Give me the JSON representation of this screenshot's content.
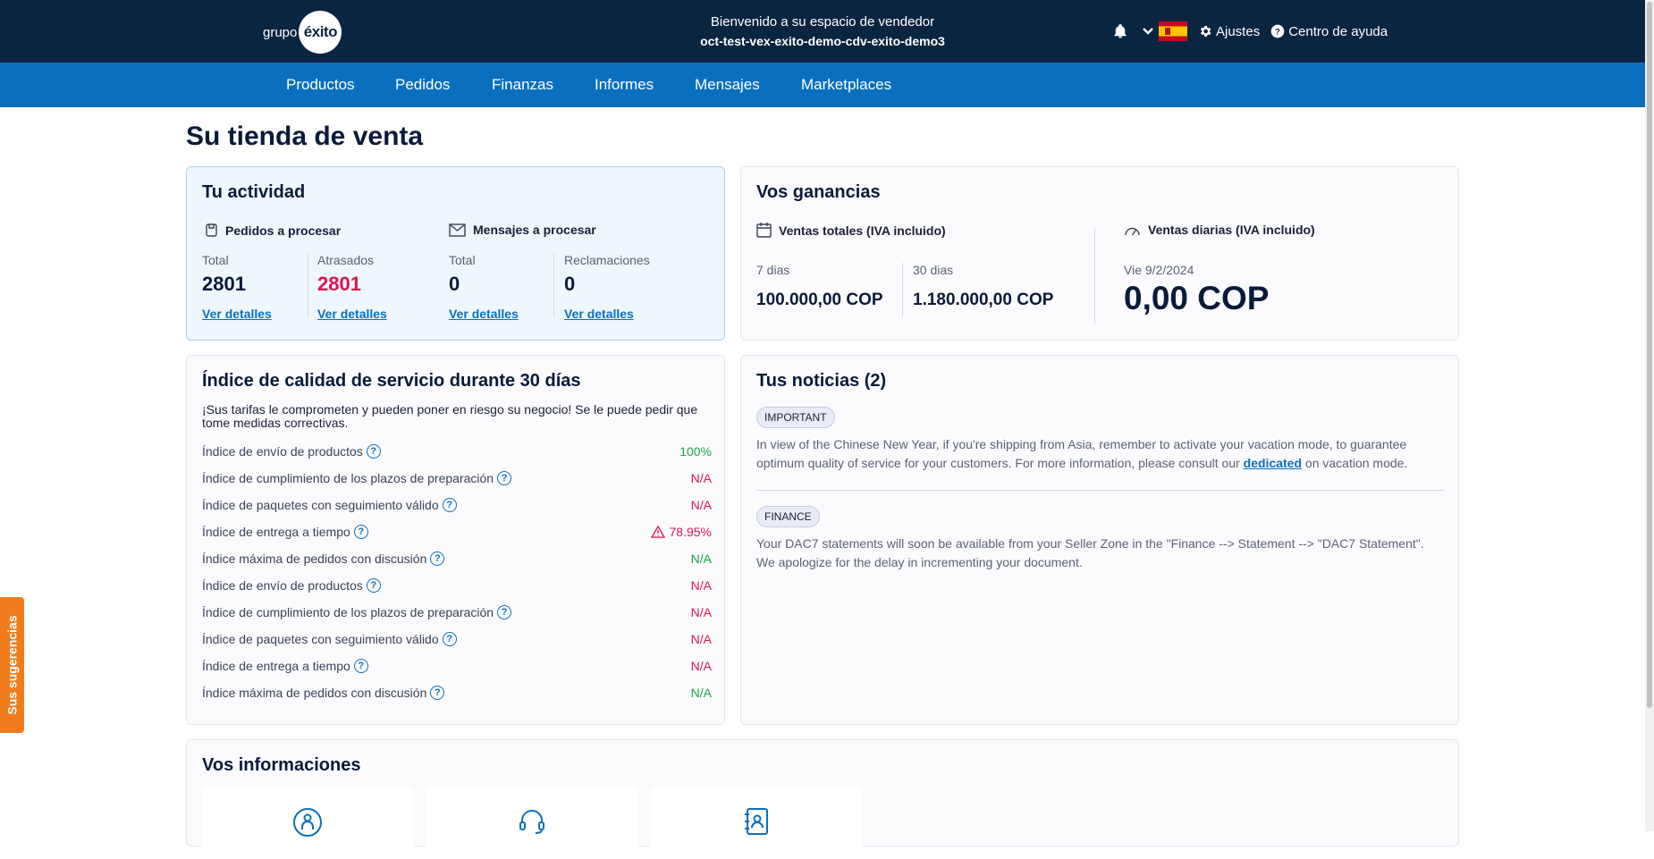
{
  "header": {
    "logo_prefix": "grupo",
    "logo_brand": "éxito",
    "welcome": "Bienvenido a su espacio de vendedor",
    "account": "oct-test-vex-exito-demo-cdv-exito-demo3",
    "settings_label": "Ajustes",
    "help_label": "Centro de ayuda"
  },
  "nav": [
    "Productos",
    "Pedidos",
    "Finanzas",
    "Informes",
    "Mensajes",
    "Marketplaces"
  ],
  "page_title": "Su tienda de venta",
  "activity": {
    "title": "Tu actividad",
    "orders_heading": "Pedidos a procesar",
    "messages_heading": "Mensajes a procesar",
    "stats": [
      {
        "label": "Total",
        "value": "2801",
        "link": "Ver detalles"
      },
      {
        "label": "Atrasados",
        "value": "2801",
        "link": "Ver detalles"
      },
      {
        "label": "Total",
        "value": "0",
        "link": "Ver detalles"
      },
      {
        "label": "Reclamaciones",
        "value": "0",
        "link": "Ver detalles"
      }
    ]
  },
  "earnings": {
    "title": "Vos ganancias",
    "total_heading": "Ventas totales (IVA incluido)",
    "daily_heading": "Ventas diarias (IVA incluido)",
    "period_7_label": "7 dias",
    "period_7_value": "100.000,00 COP",
    "period_30_label": "30 dias",
    "period_30_value": "1.180.000,00 COP",
    "daily_date": "Vie 9/2/2024",
    "daily_value": "0,00 COP"
  },
  "quality": {
    "title": "Índice de calidad de servicio durante 30 días",
    "warning": "¡Sus tarifas le comprometen y pueden poner en riesgo su negocio! Se le puede pedir que tome medidas correctivas.",
    "rows": [
      {
        "label": "Índice de envío de productos",
        "value": "100%",
        "status": "green",
        "warn": false
      },
      {
        "label": "Índice de cumplimiento de los plazos de preparación",
        "value": "N/A",
        "status": "red",
        "warn": false
      },
      {
        "label": "Índice de paquetes con seguimiento válido",
        "value": "N/A",
        "status": "red",
        "warn": false
      },
      {
        "label": "Índice de entrega a tiempo",
        "value": "78.95%",
        "status": "red",
        "warn": true
      },
      {
        "label": "Índice máxima de pedidos con discusión",
        "value": "N/A",
        "status": "green",
        "warn": false
      },
      {
        "label": "Índice de envío de productos",
        "value": "N/A",
        "status": "red",
        "warn": false
      },
      {
        "label": "Índice de cumplimiento de los plazos de preparación",
        "value": "N/A",
        "status": "red",
        "warn": false
      },
      {
        "label": "Índice de paquetes con seguimiento válido",
        "value": "N/A",
        "status": "red",
        "warn": false
      },
      {
        "label": "Índice de entrega a tiempo",
        "value": "N/A",
        "status": "red",
        "warn": false
      },
      {
        "label": "Índice máxima de pedidos con discusión",
        "value": "N/A",
        "status": "green",
        "warn": false
      }
    ]
  },
  "news": {
    "title": "Tus noticias (2)",
    "items": [
      {
        "badge": "IMPORTANT",
        "text_before": "In view of the Chinese New Year, if you're shipping from Asia, remember to activate your vacation mode, to guarantee optimum quality of service for your customers. For more information, please consult our ",
        "link": "dedicated",
        "text_after": " on vacation mode."
      },
      {
        "badge": "FINANCE",
        "text_before": "Your DAC7 statements will soon be available from your Seller Zone in the \"Finance --> Statement --> \"DAC7 Statement\". We apologize for the delay in incrementing your document.",
        "link": "",
        "text_after": ""
      }
    ]
  },
  "info": {
    "title": "Vos informaciones"
  },
  "feedback_label": "Sus sugerencias",
  "colors": {
    "topbar": "#0a2540",
    "navbar": "#0a6fbf",
    "accent_red": "#e0144c",
    "accent_green": "#17a34a",
    "feedback": "#f07c1d"
  }
}
